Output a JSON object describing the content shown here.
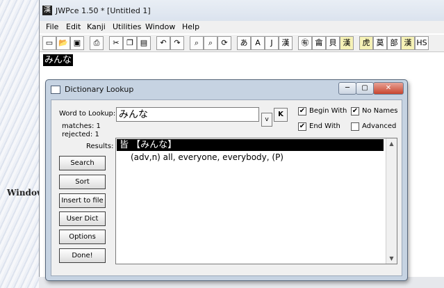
{
  "background": {
    "label": "Window"
  },
  "app": {
    "title": "JWPce 1.50 * [Untitled 1]",
    "icon": "kanji-app-icon"
  },
  "menu": [
    "File",
    "Edit",
    "Kanji",
    "Utilities",
    "Window",
    "Help"
  ],
  "toolbar": {
    "buttons": [
      "new-icon",
      "open-icon",
      "save-icon",
      "print-icon",
      "cut-icon",
      "copy-icon",
      "paste-icon",
      "undo-icon",
      "redo-icon",
      "search-icon",
      "replace-icon",
      "search-next-icon",
      "hiragana-mode",
      "ascii-mode",
      "jis-mode",
      "kanji-mode",
      "lookup-icon",
      "radical-icon",
      "bushu-icon",
      "reading-icon",
      "dict-icon",
      "kanji-info-icon",
      "radical-lookup-icon",
      "kanji-lookup-icon",
      "hs-icon"
    ],
    "labels": {
      "hiragana": "あ",
      "ascii": "A",
      "jis": "J",
      "kanji": "漢",
      "kanji2": "漢",
      "hs": "HS"
    }
  },
  "editor": {
    "selected_text": "みんな"
  },
  "dialog": {
    "title": "Dictionary Lookup",
    "lookup_label": "Word to Lookup:",
    "lookup_value": "みんな",
    "matches": "matches: 1",
    "rejected": "rejected: 1",
    "results_label": "Results:",
    "dropdown": "v",
    "k_button": "K",
    "checkboxes": [
      {
        "label": "Begin With",
        "checked": true
      },
      {
        "label": "No Names",
        "checked": true
      },
      {
        "label": "End With",
        "checked": true
      },
      {
        "label": "Advanced",
        "checked": false
      }
    ],
    "buttons": [
      "Search",
      "Sort",
      "Insert to file",
      "User Dict",
      "Options",
      "Done!"
    ],
    "result": {
      "headword": "皆 【みんな】",
      "definition": "(adv,n) all, everyone, everybody, (P)"
    }
  }
}
